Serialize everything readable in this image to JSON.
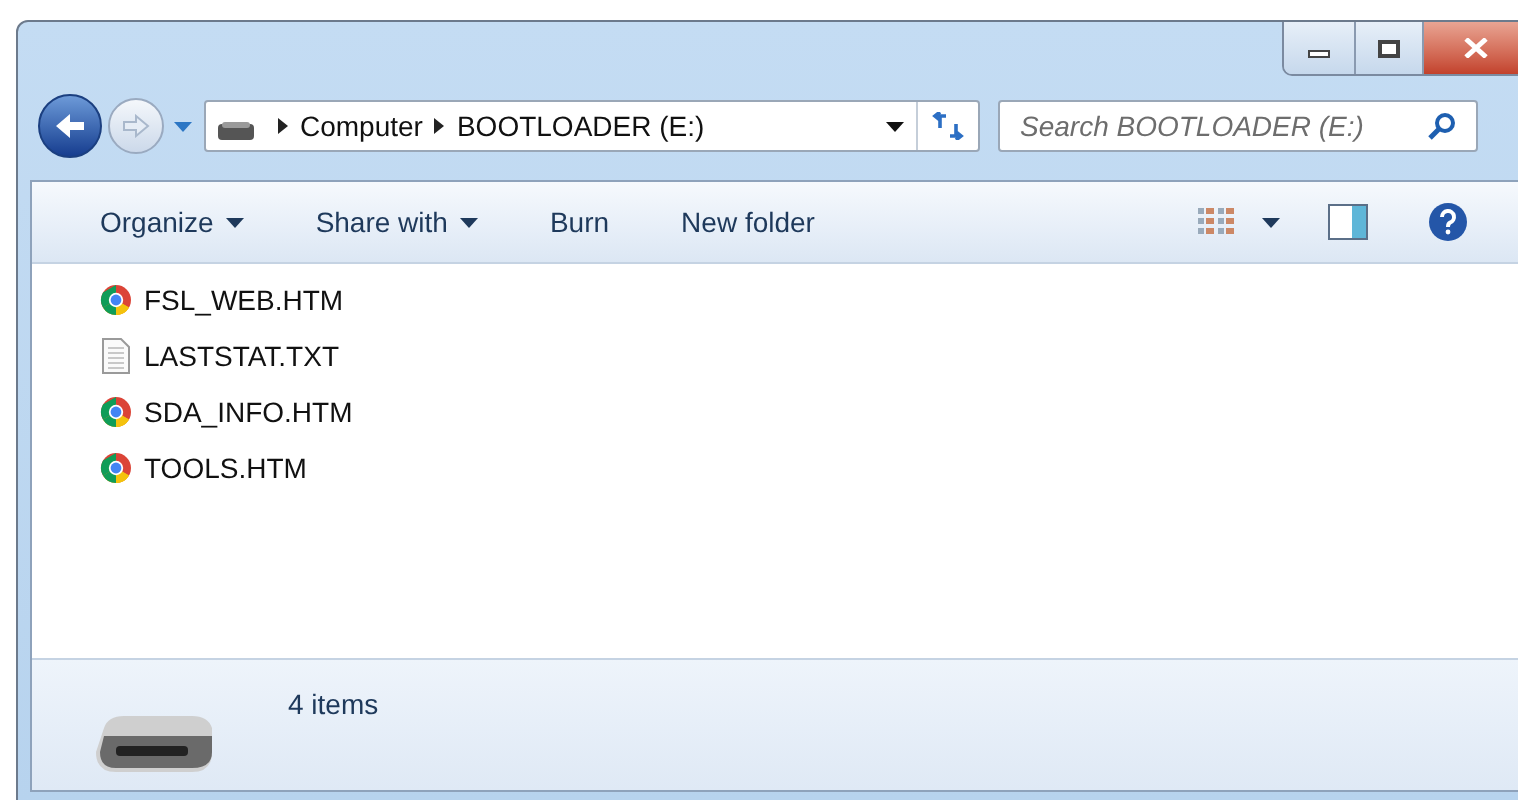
{
  "address": {
    "crumbs": [
      "Computer",
      "BOOTLOADER (E:)"
    ]
  },
  "search": {
    "placeholder": "Search BOOTLOADER (E:)"
  },
  "toolbar": {
    "items": [
      {
        "label": "Organize",
        "dropdown": true
      },
      {
        "label": "Share with",
        "dropdown": true
      },
      {
        "label": "Burn",
        "dropdown": false
      },
      {
        "label": "New folder",
        "dropdown": false
      }
    ]
  },
  "files": [
    {
      "name": "FSL_WEB.HTM",
      "kind": "web"
    },
    {
      "name": "LASTSTAT.TXT",
      "kind": "text"
    },
    {
      "name": "SDA_INFO.HTM",
      "kind": "web"
    },
    {
      "name": "TOOLS.HTM",
      "kind": "web"
    }
  ],
  "details": {
    "count": "4 items"
  }
}
